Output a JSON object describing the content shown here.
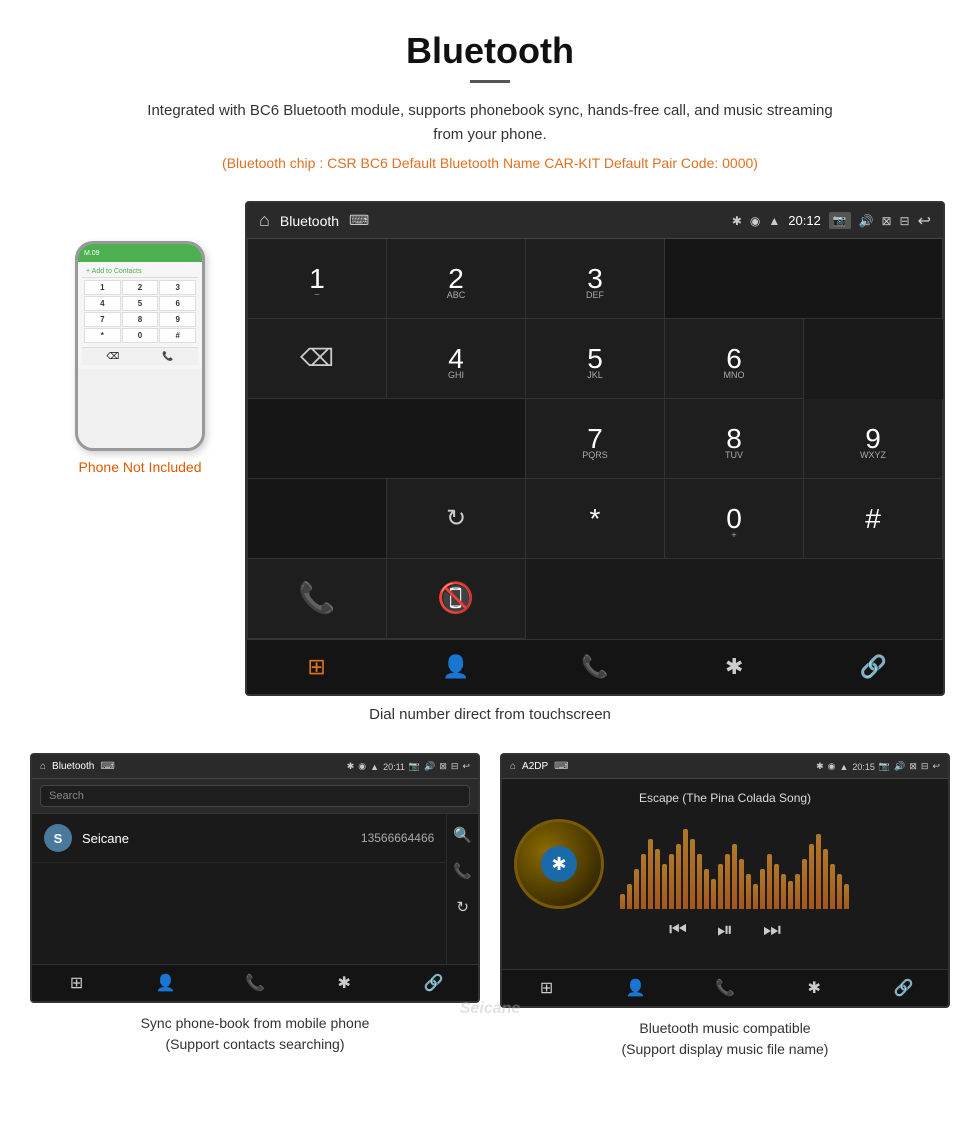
{
  "header": {
    "title": "Bluetooth",
    "description": "Integrated with BC6 Bluetooth module, supports phonebook sync, hands-free call, and music streaming from your phone.",
    "specs": "(Bluetooth chip : CSR BC6   Default Bluetooth Name CAR-KIT   Default Pair Code: 0000)"
  },
  "dialpad_screen": {
    "status_bar": {
      "title": "Bluetooth",
      "usb_symbol": "⌨",
      "time": "20:12",
      "icons": [
        "📷",
        "🔊",
        "⊠",
        "⊟"
      ]
    },
    "keys": [
      {
        "number": "1",
        "letters": ""
      },
      {
        "number": "2",
        "letters": "ABC"
      },
      {
        "number": "3",
        "letters": "DEF"
      },
      {
        "number": "4",
        "letters": "GHI"
      },
      {
        "number": "5",
        "letters": "JKL"
      },
      {
        "number": "6",
        "letters": "MNO"
      },
      {
        "number": "7",
        "letters": "PQRS"
      },
      {
        "number": "8",
        "letters": "TUV"
      },
      {
        "number": "9",
        "letters": "WXYZ"
      },
      {
        "number": "*",
        "letters": ""
      },
      {
        "number": "0",
        "letters": "+"
      },
      {
        "number": "#",
        "letters": ""
      }
    ],
    "bottom_nav": [
      "⊞",
      "👤",
      "📞",
      "✱",
      "🔗"
    ]
  },
  "main_caption": "Dial number direct from touchscreen",
  "phone_sidebar": {
    "not_included_label": "Phone Not Included"
  },
  "phonebook_screen": {
    "status_bar": {
      "title": "Bluetooth",
      "time": "20:11"
    },
    "search_placeholder": "Search",
    "contacts": [
      {
        "initial": "S",
        "name": "Seicane",
        "number": "13566664466"
      }
    ],
    "caption": "Sync phone-book from mobile phone\n(Support contacts searching)"
  },
  "music_screen": {
    "status_bar": {
      "title": "A2DP",
      "time": "20:15"
    },
    "song_title": "Escape (The Pina Colada Song)",
    "viz_bars": [
      15,
      25,
      40,
      55,
      70,
      60,
      45,
      55,
      65,
      80,
      70,
      55,
      40,
      30,
      45,
      55,
      65,
      50,
      35,
      25,
      40,
      55,
      45,
      35,
      28,
      35,
      50,
      65,
      75,
      60,
      45,
      35,
      25
    ],
    "caption": "Bluetooth music compatible\n(Support display music file name)"
  }
}
